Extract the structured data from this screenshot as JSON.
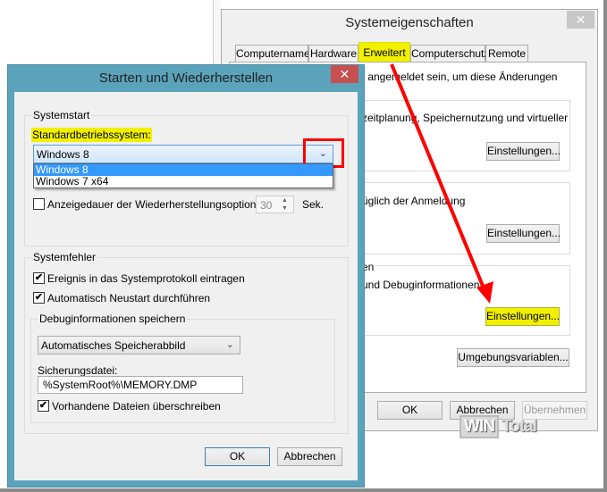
{
  "back_window": {
    "title": "Systemeigenschaften",
    "close_icon": "close-icon",
    "tabs": [
      {
        "label": "Computername"
      },
      {
        "label": "Hardware"
      },
      {
        "label": "Erweitert"
      },
      {
        "label": "Computerschutz"
      },
      {
        "label": "Remote"
      }
    ],
    "admin_note": "r angemeldet sein, um diese Änderungen",
    "performance_text": "zeitplanung, Speichernutzung und virtueller",
    "profiles_text": "üglich der Anmeldung",
    "startup_legend": "en",
    "startup_text": "und Debuginformationen",
    "settings_label": "Einstellungen...",
    "env_label": "Umgebungsvariablen...",
    "ok": "OK",
    "cancel": "Abbrechen",
    "apply": "Übernehmen"
  },
  "watermark": {
    "text1": "WIN",
    "text2": "Total"
  },
  "dialog": {
    "title": "Starten und Wiederherstellen",
    "systemstart": {
      "legend": "Systemstart",
      "default_os_label": "Standardbetriebssystem:",
      "default_os_value": "Windows 8",
      "os_options": [
        "Windows 8",
        "Windows 7 x64"
      ],
      "show_recovery_label": "Anzeigedauer der Wiederherstellungsoptionen:",
      "recovery_seconds": "30",
      "seconds_unit": "Sek."
    },
    "systemfehler": {
      "legend": "Systemfehler",
      "log_event": "Ereignis in das Systemprotokoll eintragen",
      "auto_restart": "Automatisch Neustart durchführen",
      "debug_legend": "Debuginformationen speichern",
      "debug_type": "Automatisches Speicherabbild",
      "dump_file_label": "Sicherungsdatei:",
      "dump_file_value": "%SystemRoot%\\MEMORY.DMP",
      "overwrite": "Vorhandene Dateien überschreiben",
      "check": "✔"
    },
    "ok": "OK",
    "cancel": "Abbrechen"
  },
  "colors": {
    "highlight": "#f0f000",
    "annotation": "#ff0000",
    "dialog_frame": "#5ba3bb",
    "selection": "#3399ff"
  }
}
